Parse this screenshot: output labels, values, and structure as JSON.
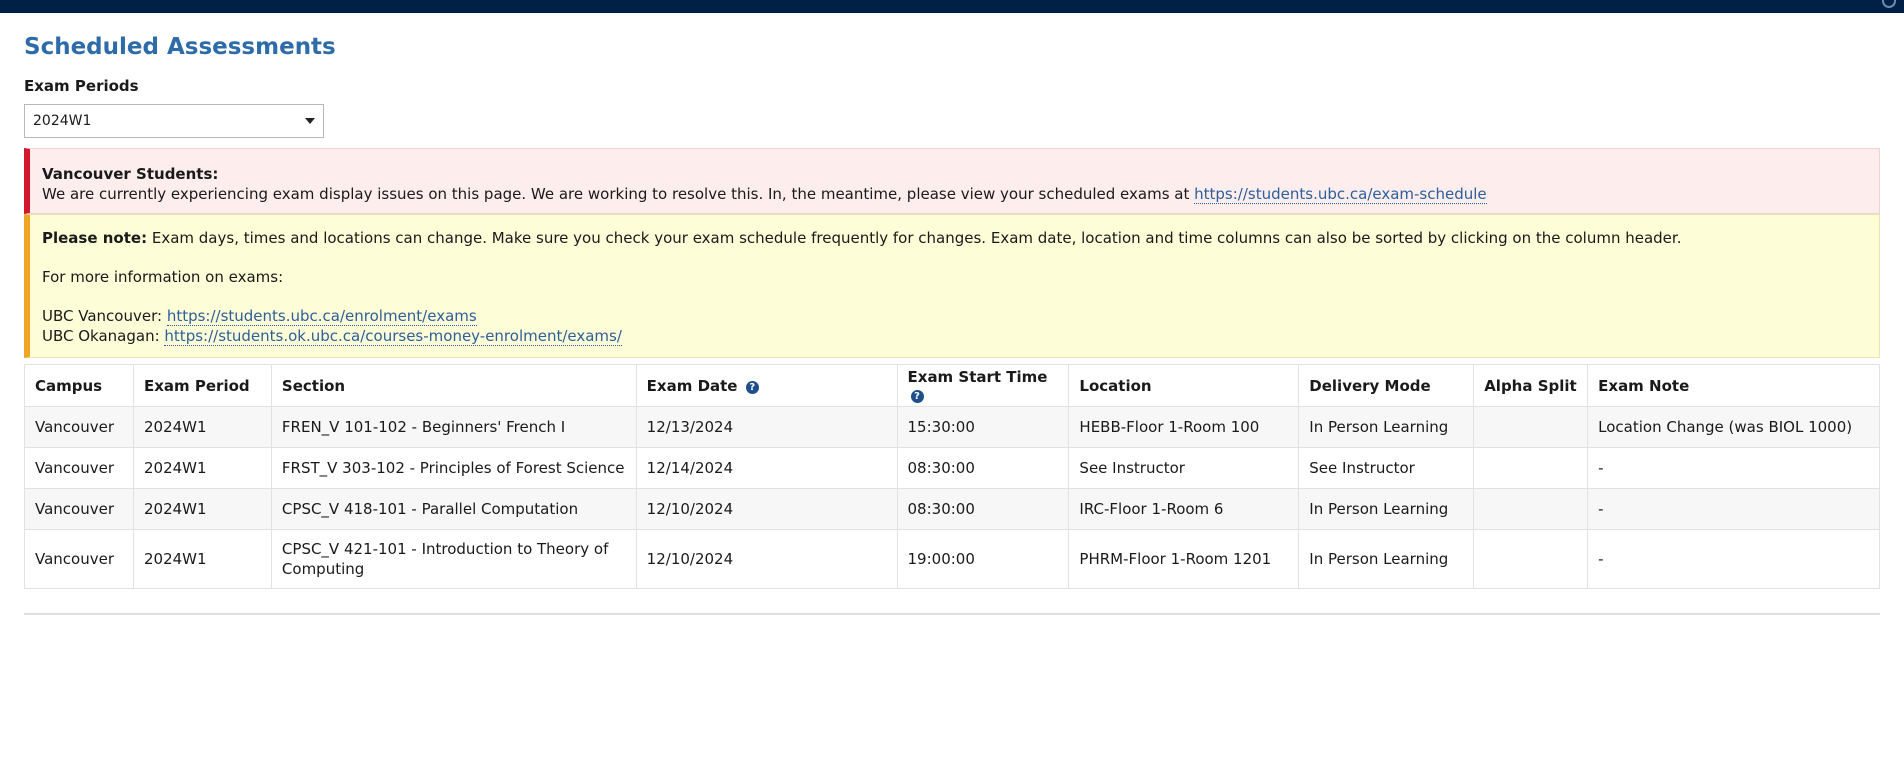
{
  "page": {
    "title": "Scheduled Assessments"
  },
  "exam_periods": {
    "label": "Exam Periods",
    "selected": "2024W1"
  },
  "alert_vancouver": {
    "heading": "Vancouver Students:",
    "message": "We are currently experiencing exam display issues on this page. We are working to resolve this. In, the meantime, please view your scheduled exams at",
    "link_text": "https://students.ubc.ca/exam-schedule"
  },
  "alert_note": {
    "heading": "Please note:",
    "message": " Exam days, times and locations can change. Make sure you check your exam schedule frequently for changes. Exam date, location and time columns can also be sorted by clicking on the column header.",
    "more_info": "For more information on exams:",
    "vancouver_label": "UBC Vancouver: ",
    "vancouver_link": "https://students.ubc.ca/enrolment/exams",
    "okanagan_label": "UBC Okanagan: ",
    "okanagan_link": "https://students.ok.ubc.ca/courses-money-enrolment/exams/"
  },
  "table": {
    "headers": {
      "campus": "Campus",
      "exam_period": "Exam Period",
      "section": "Section",
      "exam_date": "Exam Date",
      "exam_start_time": "Exam Start Time",
      "location": "Location",
      "delivery_mode": "Delivery Mode",
      "alpha_split": "Alpha Split",
      "exam_note": "Exam Note"
    },
    "help_icon_glyph": "?",
    "rows": [
      {
        "campus": "Vancouver",
        "exam_period": "2024W1",
        "section": "FREN_V 101-102 - Beginners' French I",
        "exam_date": "12/13/2024",
        "exam_start_time": "15:30:00",
        "location": "HEBB-Floor 1-Room 100",
        "delivery_mode": "In Person Learning",
        "alpha_split": "",
        "exam_note": "Location Change (was BIOL 1000)"
      },
      {
        "campus": "Vancouver",
        "exam_period": "2024W1",
        "section": "FRST_V 303-102 - Principles of Forest Science",
        "exam_date": "12/14/2024",
        "exam_start_time": "08:30:00",
        "location": "See Instructor",
        "delivery_mode": "See Instructor",
        "alpha_split": "",
        "exam_note": "-"
      },
      {
        "campus": "Vancouver",
        "exam_period": "2024W1",
        "section": "CPSC_V 418-101 - Parallel Computation",
        "exam_date": "12/10/2024",
        "exam_start_time": "08:30:00",
        "location": "IRC-Floor 1-Room 6",
        "delivery_mode": "In Person Learning",
        "alpha_split": "",
        "exam_note": "-"
      },
      {
        "campus": "Vancouver",
        "exam_period": "2024W1",
        "section": "CPSC_V 421-101 - Introduction to Theory of Computing",
        "exam_date": "12/10/2024",
        "exam_start_time": "19:00:00",
        "location": "PHRM-Floor 1-Room 1201",
        "delivery_mode": "In Person Learning",
        "alpha_split": "",
        "exam_note": "-"
      }
    ]
  },
  "colors": {
    "title": "#2d6ca8",
    "topbar": "#002145",
    "alert_red_border": "#d3182d",
    "alert_yellow_border": "#f0a524",
    "link": "#2d5f9a"
  }
}
